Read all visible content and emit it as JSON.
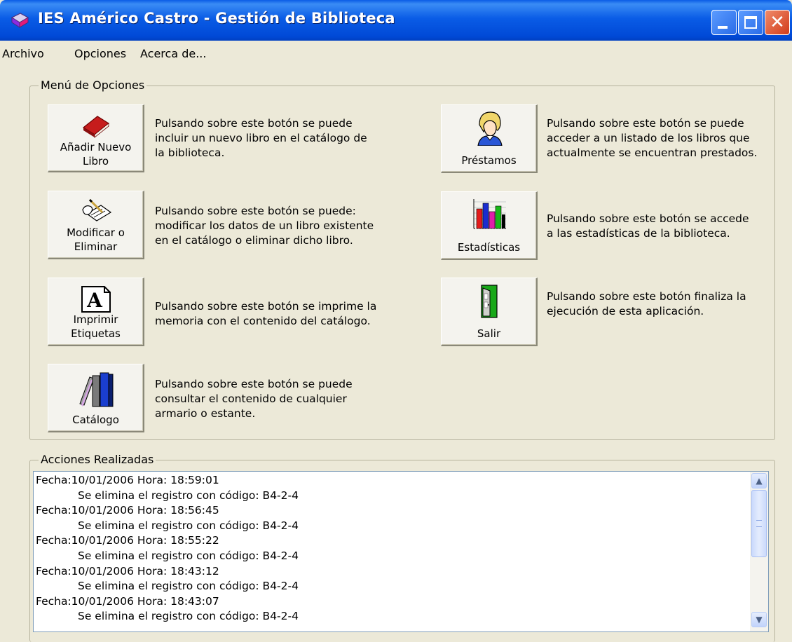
{
  "window": {
    "title": "IES Américo Castro - Gestión de Biblioteca",
    "close_glyph": "✕"
  },
  "menubar": {
    "items": [
      "Archivo",
      "Opciones",
      "Acerca de..."
    ]
  },
  "options_group": {
    "title": "Menú de Opciones",
    "buttons": [
      {
        "label_line1": "Añadir Nuevo",
        "label_line2": "Libro",
        "icon": "red-book-icon",
        "desc": [
          "Pulsando sobre este botón se puede",
          "incluir un nuevo libro en el catálogo de",
          "la biblioteca."
        ]
      },
      {
        "label_line1": "Modificar o",
        "label_line2": "Eliminar",
        "icon": "writing-hand-icon",
        "desc": [
          "Pulsando sobre este botón se puede:",
          "modificar los datos de un libro existente",
          "en el catálogo o eliminar dicho libro."
        ]
      },
      {
        "label_line1": "Imprimir",
        "label_line2": "Etiquetas",
        "icon": "letter-a-page-icon",
        "icon_letter": "A",
        "desc": [
          "Pulsando sobre este botón se imprime la",
          "memoria con el contenido del catálogo."
        ]
      },
      {
        "label_line1": "",
        "label_line2": "Catálogo",
        "icon": "books-icon",
        "desc": [
          "Pulsando sobre este botón se puede",
          "consultar el contenido de cualquier",
          "armario o estante."
        ]
      },
      {
        "label_line1": "",
        "label_line2": "Préstamos",
        "icon": "person-icon",
        "desc": [
          "Pulsando sobre este botón se puede",
          "acceder a un listado de los libros que",
          "actualmente se encuentran prestados."
        ]
      },
      {
        "label_line1": "",
        "label_line2": "Estadísticas",
        "icon": "bar-chart-icon",
        "desc": [
          "Pulsando sobre este botón se accede",
          "a las estadísticas de la biblioteca."
        ]
      },
      {
        "label_line1": "",
        "label_line2": "Salir",
        "icon": "door-icon",
        "desc": [
          "Pulsando sobre este botón finaliza la",
          "ejecución de esta aplicación."
        ]
      }
    ]
  },
  "actions_group": {
    "title": "Acciones Realizadas",
    "log": [
      {
        "date_line": "Fecha:10/01/2006 Hora: 18:59:01",
        "action": "Se elimina el registro con código: B4-2-4"
      },
      {
        "date_line": "Fecha:10/01/2006 Hora: 18:56:45",
        "action": "Se elimina el registro con código: B4-2-4"
      },
      {
        "date_line": "Fecha:10/01/2006 Hora: 18:55:22",
        "action": "Se elimina el registro con código: B4-2-4"
      },
      {
        "date_line": "Fecha:10/01/2006 Hora: 18:43:12",
        "action": "Se elimina el registro con código: B4-2-4"
      },
      {
        "date_line": "Fecha:10/01/2006 Hora: 18:43:07",
        "action": "Se elimina el registro con código: B4-2-4"
      }
    ],
    "scroll_up_glyph": "▲",
    "scroll_down_glyph": "▼"
  }
}
